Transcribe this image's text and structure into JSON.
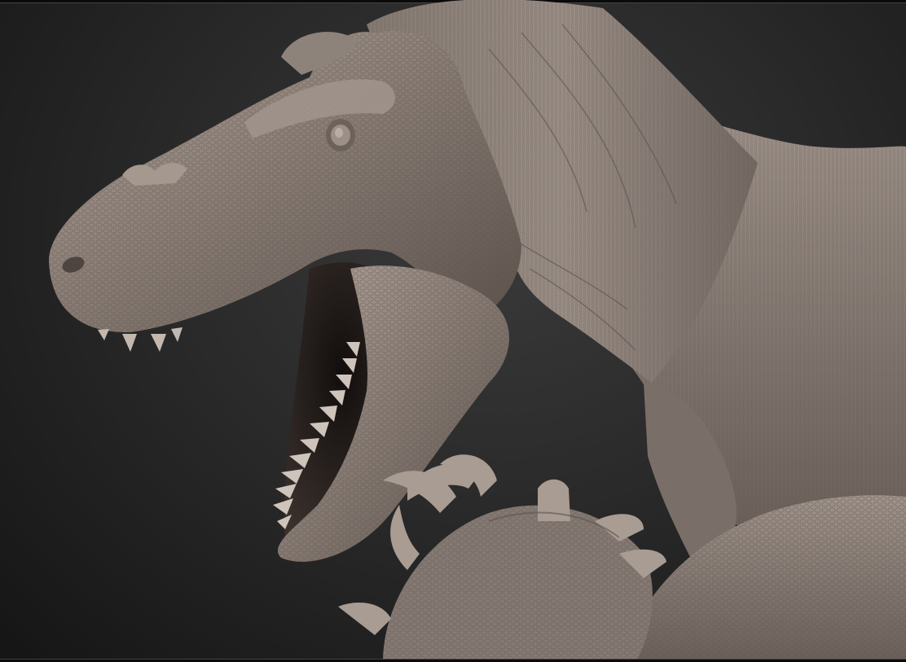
{
  "scene": {
    "subject": "sculpt-render",
    "colors": {
      "background_center": "#3a3a3a",
      "background_edge": "#151515",
      "clay_light": "#a89c93",
      "clay_mid": "#7d716a",
      "clay_dark": "#4b423d",
      "mouth_dark": "#1c1615"
    }
  }
}
